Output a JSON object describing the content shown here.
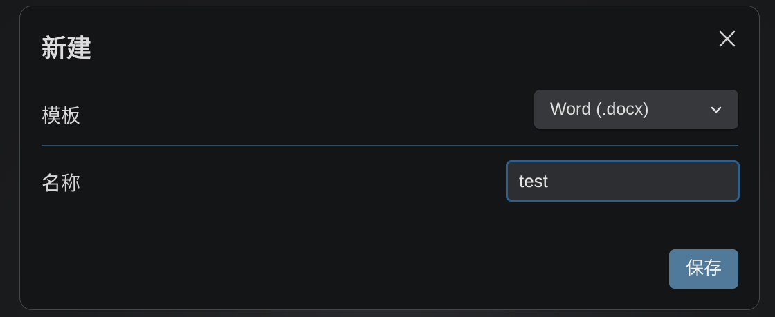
{
  "modal": {
    "title": "新建",
    "close_icon": "close-icon"
  },
  "settings": {
    "template": {
      "label": "模板",
      "selected": "Word (.docx)",
      "icon": "chevron-down-icon"
    },
    "name": {
      "label": "名称",
      "value": "test"
    }
  },
  "actions": {
    "save_label": "保存"
  },
  "colors": {
    "accent": "#517a9a",
    "focus_border": "#2f5f8c",
    "divider": "#2d4a62",
    "modal_bg": "#141517"
  }
}
